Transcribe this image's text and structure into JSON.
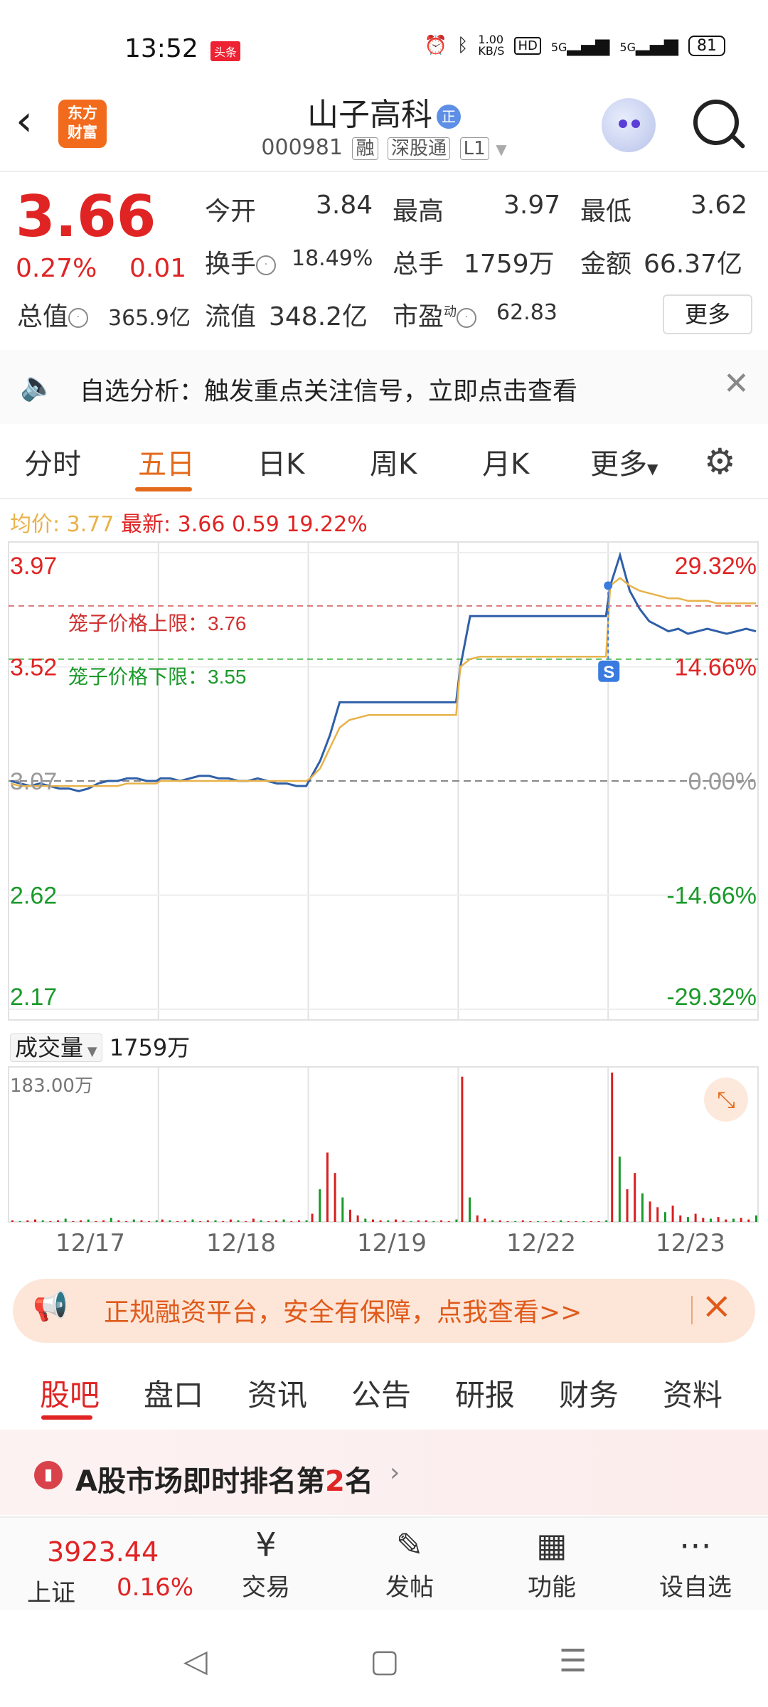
{
  "status_bar": {
    "time": "13:52",
    "tag": "头条",
    "net_speed": "1.00\nKB/S",
    "hd": "HD",
    "signal1": "5G",
    "signal2": "5G",
    "battery": "81"
  },
  "header": {
    "logo_text": "东方\n财富",
    "title": "山子高科",
    "title_badge": "正",
    "code": "000981",
    "tags": [
      "融",
      "深股通",
      "L1"
    ]
  },
  "quote": {
    "price": "3.66",
    "change_pct": "0.27%",
    "change": "0.01",
    "open_label": "今开",
    "open": "3.84",
    "high_label": "最高",
    "high": "3.97",
    "low_label": "最低",
    "low": "3.62",
    "turnover_label": "换手",
    "turnover": "18.49%",
    "volume_label": "总手",
    "volume": "1759万",
    "amount_label": "金额",
    "amount": "66.37亿",
    "mktcap_label": "总值",
    "mktcap": "365.9亿",
    "float_label": "流值",
    "float": "348.2亿",
    "pe_label": "市盈",
    "pe_sup": "动",
    "pe": "62.83",
    "more_label": "更多"
  },
  "notice": {
    "text": "自选分析：触发重点关注信号，立即点击查看"
  },
  "chart_tabs": [
    {
      "label": "分时"
    },
    {
      "label": "五日"
    },
    {
      "label": "日K"
    },
    {
      "label": "周K"
    },
    {
      "label": "月K"
    },
    {
      "label": "更多"
    }
  ],
  "legend": {
    "avg_label": "均价:",
    "avg": "3.77",
    "latest_label": "最新:",
    "latest": "3.66",
    "latest_chg": "0.59",
    "latest_pct": "19.22%"
  },
  "chart_data": {
    "type": "line",
    "title": "",
    "x": [
      "12/17",
      "12/18",
      "12/19",
      "12/22",
      "12/23"
    ],
    "y_ticks_left": [
      "3.97",
      "3.52",
      "3.07",
      "2.62",
      "2.17"
    ],
    "y_ticks_right": [
      "29.32%",
      "14.66%",
      "0.00%",
      "-14.66%",
      "-29.32%"
    ],
    "ylim": [
      2.17,
      3.97
    ],
    "annotations": [
      {
        "text": "笼子价格上限：3.76",
        "value": 3.76
      },
      {
        "text": "笼子价格下限：3.55",
        "value": 3.55
      }
    ],
    "marker": "S",
    "series": [
      {
        "key": "price",
        "color": "#2f5fa8",
        "days": [
          [
            3.07,
            3.06,
            3.05,
            3.06,
            3.05,
            3.04,
            3.04,
            3.03,
            3.04,
            3.06,
            3.07,
            3.07,
            3.08,
            3.08,
            3.07,
            3.07
          ],
          [
            3.08,
            3.08,
            3.07,
            3.08,
            3.09,
            3.09,
            3.08,
            3.08,
            3.07,
            3.07,
            3.08,
            3.07,
            3.06,
            3.06,
            3.05,
            3.05
          ],
          [
            3.08,
            3.15,
            3.25,
            3.38,
            3.38,
            3.38,
            3.38,
            3.38,
            3.38,
            3.38,
            3.38,
            3.38,
            3.38,
            3.38,
            3.38,
            3.38
          ],
          [
            3.52,
            3.72,
            3.72,
            3.72,
            3.72,
            3.72,
            3.72,
            3.72,
            3.72,
            3.72,
            3.72,
            3.72,
            3.72,
            3.72,
            3.72,
            3.72
          ],
          [
            3.84,
            3.96,
            3.82,
            3.75,
            3.7,
            3.68,
            3.66,
            3.67,
            3.65,
            3.66,
            3.67,
            3.66,
            3.65,
            3.66,
            3.67,
            3.66
          ]
        ]
      },
      {
        "key": "avg",
        "color": "#e8b24a",
        "days": [
          [
            3.06,
            3.05,
            3.05,
            3.05,
            3.05,
            3.05,
            3.05,
            3.05,
            3.05,
            3.05,
            3.05,
            3.05,
            3.06,
            3.06,
            3.06,
            3.06
          ],
          [
            3.07,
            3.07,
            3.07,
            3.07,
            3.07,
            3.07,
            3.07,
            3.07,
            3.07,
            3.07,
            3.07,
            3.07,
            3.07,
            3.07,
            3.07,
            3.07
          ],
          [
            3.08,
            3.12,
            3.2,
            3.28,
            3.31,
            3.32,
            3.33,
            3.33,
            3.33,
            3.33,
            3.33,
            3.33,
            3.33,
            3.33,
            3.33,
            3.33
          ],
          [
            3.52,
            3.55,
            3.56,
            3.56,
            3.56,
            3.56,
            3.56,
            3.56,
            3.56,
            3.56,
            3.56,
            3.56,
            3.56,
            3.56,
            3.56,
            3.56
          ],
          [
            3.84,
            3.87,
            3.84,
            3.82,
            3.81,
            3.8,
            3.79,
            3.79,
            3.78,
            3.78,
            3.78,
            3.77,
            3.77,
            3.77,
            3.77,
            3.77
          ]
        ]
      }
    ]
  },
  "volume": {
    "label": "成交量",
    "value": "1759万",
    "max_label": "183.00万",
    "chart_data": {
      "type": "bar",
      "ylim": [
        0,
        183
      ],
      "days": [
        [
          2,
          1,
          2,
          3,
          2,
          1,
          2,
          4,
          1,
          2,
          3,
          1,
          2,
          5,
          2,
          1,
          3,
          2,
          1,
          2
        ],
        [
          3,
          2,
          1,
          2,
          3,
          1,
          2,
          2,
          1,
          3,
          2,
          1,
          4,
          2,
          1,
          2,
          3,
          1,
          2,
          2
        ],
        [
          10,
          40,
          85,
          60,
          30,
          15,
          8,
          4,
          3,
          2,
          2,
          3,
          2,
          1,
          2,
          2,
          1,
          2,
          1,
          3
        ],
        [
          178,
          30,
          8,
          4,
          2,
          2,
          1,
          1,
          2,
          1,
          1,
          1,
          1,
          2,
          1,
          1,
          1,
          1,
          1,
          2
        ],
        [
          183,
          80,
          40,
          60,
          35,
          25,
          18,
          12,
          20,
          8,
          6,
          10,
          5,
          4,
          6,
          3,
          4,
          5,
          3,
          8
        ]
      ]
    }
  },
  "ad": {
    "text": "正规融资平台，安全有保障，点我查看>>"
  },
  "bottom_tabs": [
    {
      "label": "股吧"
    },
    {
      "label": "盘口"
    },
    {
      "label": "资讯"
    },
    {
      "label": "公告"
    },
    {
      "label": "研报"
    },
    {
      "label": "财务"
    },
    {
      "label": "资料"
    }
  ],
  "rank": {
    "text_pre": "A股市场即时排名第",
    "num": "2",
    "text_post": "名"
  },
  "toolbar": {
    "index_value": "3923.44",
    "index_name": "上证",
    "index_pct": "0.16%",
    "items": [
      {
        "label": "交易"
      },
      {
        "label": "发帖"
      },
      {
        "label": "功能"
      },
      {
        "label": "设自选"
      }
    ]
  },
  "colors": {
    "accent": "#e36a1b",
    "up": "#e02424",
    "down": "#1a9a2a",
    "price_line": "#2f5fa8",
    "avg_line": "#e8b24a"
  }
}
